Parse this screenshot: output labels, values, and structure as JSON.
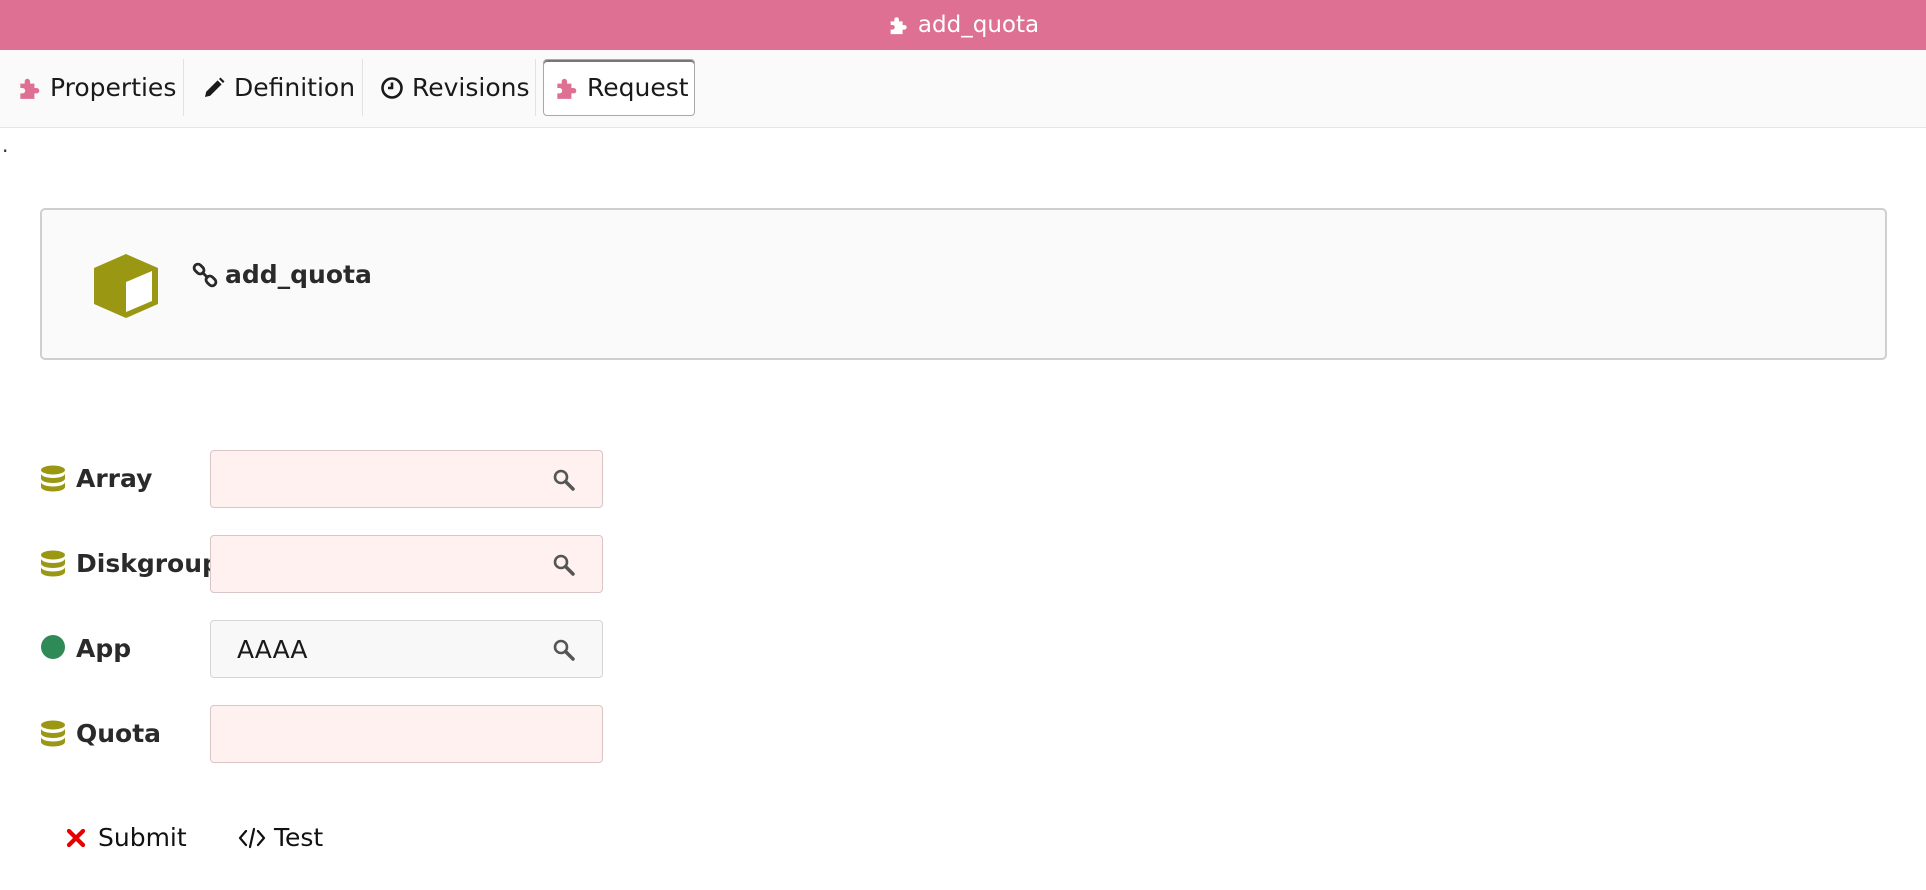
{
  "window": {
    "title": "add_quota"
  },
  "tabs": [
    {
      "label": "Properties",
      "icon": "puzzle-icon"
    },
    {
      "label": "Definition",
      "icon": "pencil-icon"
    },
    {
      "label": "Revisions",
      "icon": "clock-icon"
    },
    {
      "label": "Request",
      "icon": "puzzle-icon",
      "active": true
    }
  ],
  "stray_mark": ".",
  "card": {
    "name": "add_quota",
    "icon": "cube-icon",
    "link_icon": "link-icon"
  },
  "fields": [
    {
      "label": "Array",
      "value": "",
      "status_icon": "database-icon",
      "searchable": true
    },
    {
      "label": "Diskgroup",
      "value": "",
      "status_icon": "database-icon",
      "searchable": true
    },
    {
      "label": "App",
      "value": "AAAA",
      "status_icon": "circle-icon",
      "searchable": true
    },
    {
      "label": "Quota",
      "value": "",
      "status_icon": "database-icon",
      "searchable": false
    }
  ],
  "actions": {
    "submit": {
      "label": "Submit",
      "icon": "x-icon"
    },
    "test": {
      "label": "Test",
      "icon": "code-icon"
    }
  },
  "colors": {
    "titlebar": "#de7093",
    "accent_pink": "#de7093",
    "olive": "#9a9712",
    "status_green": "#2e8b57",
    "required_bg": "#fff1ef",
    "error_red": "#e60000"
  }
}
